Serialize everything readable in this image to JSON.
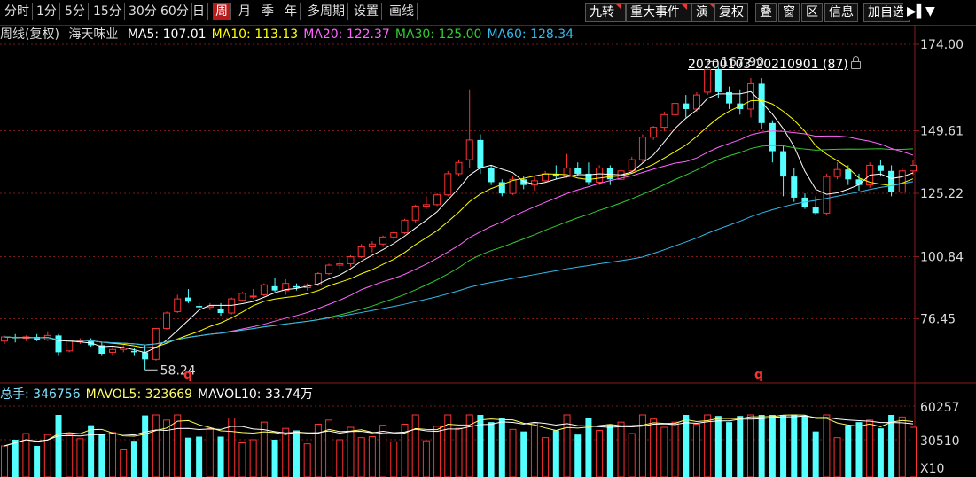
{
  "toolbar": {
    "periods": [
      "分时",
      "1分",
      "5分",
      "15分",
      "30分",
      "60分",
      "日",
      "周",
      "月",
      "季",
      "年",
      "多周期",
      "设置",
      "画线"
    ],
    "active_period": "周",
    "right_tools": [
      "九转",
      "重大事件",
      "演",
      "复权",
      "叠",
      "窗",
      "区",
      "信息",
      "加自选"
    ],
    "right_flag_indices": [
      0,
      1,
      2
    ]
  },
  "legend": {
    "name": "周线(复权)",
    "stock": "海天味业",
    "items": [
      {
        "label": "MA5: 107.01",
        "color": "#ffffff"
      },
      {
        "label": "MA10: 113.13",
        "color": "#ffff00"
      },
      {
        "label": "MA20: 122.37",
        "color": "#ff66ff"
      },
      {
        "label": "MA30: 125.00",
        "color": "#33cc33"
      },
      {
        "label": "MA60: 128.34",
        "color": "#33bbee"
      }
    ]
  },
  "range_label": "20200103-20210901 (87)",
  "annotations": {
    "high": "167.90",
    "low": "58.24",
    "marker": "q"
  },
  "volume_legend": {
    "items": [
      {
        "label": "总手: 346756",
        "color": "#7fe3ff"
      },
      {
        "label": "MAVOL5: 323669",
        "color": "#ffff66"
      },
      {
        "label": "MAVOL10: 33.74万",
        "color": "#ffffff"
      }
    ],
    "axis_labels": [
      "60257",
      "30510",
      "X10"
    ]
  },
  "chart_data": {
    "type": "candlestick",
    "y_ticks": [
      174.0,
      149.61,
      125.22,
      100.84,
      76.45
    ],
    "ylim": [
      56,
      176
    ],
    "grid": true,
    "candles": [
      [
        68.5,
        70.5,
        67.5,
        70
      ],
      [
        70,
        71,
        68,
        69.5
      ],
      [
        69.5,
        70.5,
        68.5,
        70
      ],
      [
        70,
        71,
        68.5,
        69
      ],
      [
        69,
        72,
        68.5,
        70.5
      ],
      [
        70.5,
        71,
        63.5,
        64.5
      ],
      [
        65,
        69,
        64.5,
        68.5
      ],
      [
        68.5,
        69.5,
        67.5,
        68.5
      ],
      [
        68.5,
        69.5,
        66.5,
        67
      ],
      [
        67,
        68,
        63.5,
        64
      ],
      [
        64.5,
        66.5,
        63.5,
        65.5
      ],
      [
        65.5,
        67,
        64.5,
        66
      ],
      [
        65,
        66,
        63.5,
        64.5
      ],
      [
        64.5,
        67,
        58.24,
        62
      ],
      [
        62,
        73,
        61.5,
        73
      ],
      [
        73,
        79,
        72.5,
        78.5
      ],
      [
        79,
        85,
        78.5,
        83.5
      ],
      [
        84,
        87,
        82,
        82.5
      ],
      [
        81,
        82,
        79.5,
        80.5
      ],
      [
        80.5,
        82,
        79.5,
        81
      ],
      [
        80,
        82,
        77.5,
        78.5
      ],
      [
        78.5,
        84,
        78,
        83.5
      ],
      [
        83,
        86,
        82.5,
        85.5
      ],
      [
        84.5,
        87,
        83.5,
        84.5
      ],
      [
        85,
        89,
        84.5,
        88.5
      ],
      [
        88,
        91,
        86,
        86.5
      ],
      [
        86.5,
        90.5,
        85,
        89
      ],
      [
        88,
        89,
        86.5,
        87.5
      ],
      [
        87.5,
        89,
        86.5,
        88.5
      ],
      [
        88.5,
        93,
        88,
        92.5
      ],
      [
        92.5,
        96,
        92,
        95.5
      ],
      [
        95.5,
        98,
        94,
        96
      ],
      [
        96,
        99,
        95,
        98.5
      ],
      [
        98.5,
        103,
        98,
        102
      ],
      [
        102,
        104,
        100,
        103
      ],
      [
        103,
        106,
        102,
        105.5
      ],
      [
        105.5,
        108,
        104,
        107
      ],
      [
        107,
        112,
        106.5,
        111.5
      ],
      [
        111.5,
        117,
        110.5,
        116.5
      ],
      [
        116.5,
        120,
        115.5,
        117
      ],
      [
        117,
        121,
        116.5,
        120.5
      ],
      [
        120.5,
        129,
        120,
        128
      ],
      [
        128,
        133,
        127,
        132
      ],
      [
        133,
        158,
        130,
        140
      ],
      [
        140,
        142,
        128,
        130
      ],
      [
        130,
        131,
        124,
        125
      ],
      [
        125,
        126,
        120,
        121
      ],
      [
        121,
        127,
        120.5,
        126
      ],
      [
        126,
        127,
        122.5,
        124
      ],
      [
        124,
        127,
        122,
        125.5
      ],
      [
        125.5,
        129,
        125,
        128
      ],
      [
        128,
        131,
        126,
        127
      ],
      [
        127,
        135,
        126.5,
        130
      ],
      [
        130,
        132,
        127,
        128
      ],
      [
        128,
        132,
        124,
        125
      ],
      [
        125,
        131,
        124,
        130
      ],
      [
        130,
        131,
        124,
        126
      ],
      [
        126,
        130,
        125,
        129
      ],
      [
        129,
        134,
        128.5,
        133
      ],
      [
        133,
        142,
        132,
        141
      ],
      [
        141,
        145,
        140,
        144.5
      ],
      [
        144.5,
        150,
        143,
        149
      ],
      [
        149,
        154,
        148,
        153
      ],
      [
        153,
        156,
        148,
        151
      ],
      [
        151,
        157,
        150,
        156
      ],
      [
        157,
        167.9,
        156,
        165
      ],
      [
        165,
        166,
        155,
        157
      ],
      [
        157,
        159,
        151,
        153
      ],
      [
        153,
        158,
        149,
        151
      ],
      [
        151,
        162,
        148,
        160
      ],
      [
        160,
        162,
        144,
        146
      ],
      [
        146,
        147,
        132,
        136
      ],
      [
        136,
        138,
        120,
        127
      ],
      [
        127,
        130,
        118,
        119.5
      ],
      [
        119.5,
        121,
        115.5,
        116
      ],
      [
        116,
        120,
        113.5,
        114
      ],
      [
        114,
        128,
        113.5,
        127
      ],
      [
        127,
        132,
        126,
        129.5
      ],
      [
        129.5,
        131,
        124,
        126
      ],
      [
        126,
        128,
        122,
        124
      ],
      [
        124,
        132,
        123,
        131
      ],
      [
        131,
        133,
        127,
        129
      ],
      [
        129,
        131,
        120,
        121.5
      ],
      [
        121.5,
        130,
        121,
        129
      ],
      [
        129,
        133,
        127.5,
        131
      ]
    ]
  }
}
